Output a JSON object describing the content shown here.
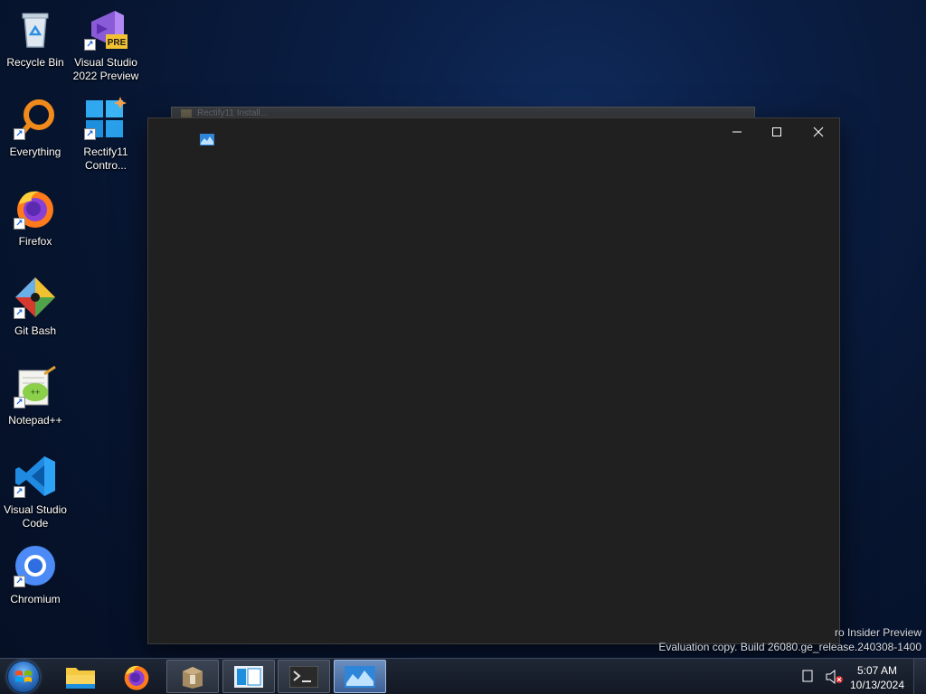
{
  "desktop": {
    "icons": [
      {
        "label": "Recycle Bin",
        "icon": "recycle-bin-icon"
      },
      {
        "label": "Visual Studio 2022 Preview",
        "icon": "visual-studio-preview-icon",
        "badge": "PRE"
      },
      {
        "label": "Everything",
        "icon": "everything-search-icon"
      },
      {
        "label": "Rectify11 Contro...",
        "icon": "rectify11-control-icon"
      },
      {
        "label": "Firefox",
        "icon": "firefox-icon"
      },
      {
        "label": "Git Bash",
        "icon": "git-bash-icon"
      },
      {
        "label": "Notepad++",
        "icon": "notepad-plus-plus-icon"
      },
      {
        "label": "Visual Studio Code",
        "icon": "vscode-icon"
      },
      {
        "label": "Chromium",
        "icon": "chromium-icon"
      }
    ]
  },
  "ghost_window": {
    "title": "Rectify11 Install..."
  },
  "window": {
    "app_icon": "app-monitor-icon",
    "minimize_icon": "minimize-icon",
    "maximize_icon": "maximize-icon",
    "close_icon": "close-icon"
  },
  "watermark": {
    "line1": "ro Insider Preview",
    "line2": "Evaluation copy. Build 26080.ge_release.240308-1400"
  },
  "taskbar": {
    "start_icon": "windows-start-orb-icon",
    "items": [
      {
        "name": "file-explorer",
        "icon": "folder-icon",
        "state": "pinned"
      },
      {
        "name": "firefox",
        "icon": "firefox-icon",
        "state": "pinned"
      },
      {
        "name": "installer",
        "icon": "package-icon",
        "state": "running"
      },
      {
        "name": "control-panel",
        "icon": "window-panel-icon",
        "state": "running"
      },
      {
        "name": "terminal",
        "icon": "terminal-icon",
        "state": "running"
      },
      {
        "name": "monitor-app",
        "icon": "app-monitor-icon",
        "state": "active"
      }
    ],
    "tray": {
      "action_center_icon": "notification-square-icon",
      "volume_icon": "volume-muted-icon"
    },
    "clock": {
      "time": "5:07 AM",
      "date": "10/13/2024"
    }
  },
  "colors": {
    "window_bg": "#202020",
    "desktop_bg": "#0a1d42",
    "taskbar_bg": "#121823",
    "active_task": "#3d5f94"
  }
}
